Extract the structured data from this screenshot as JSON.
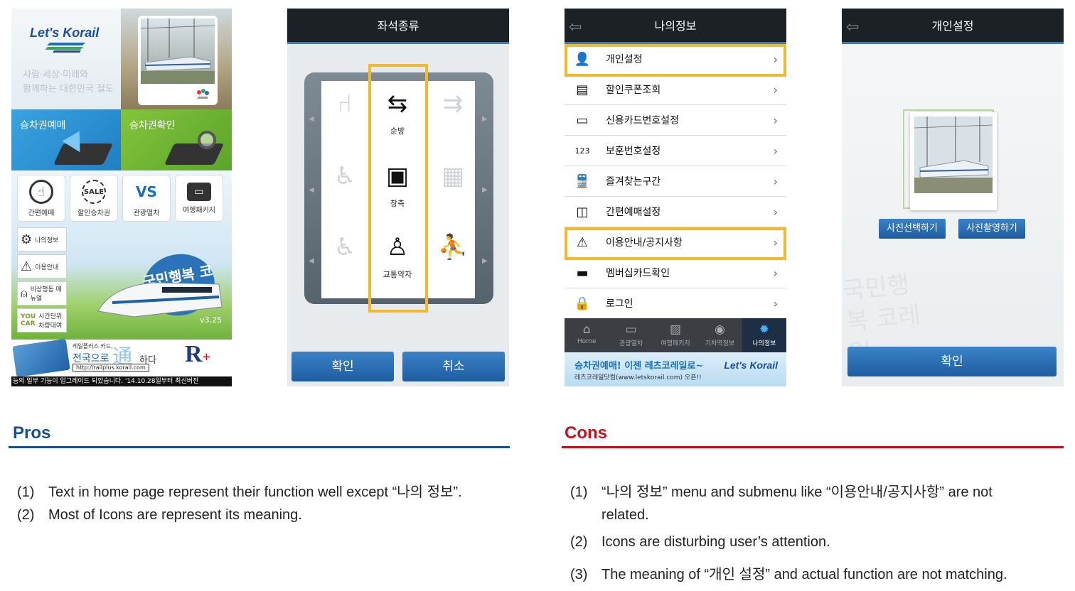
{
  "screen1": {
    "logo": "Let's Korail",
    "slogan_line1": "사람·세상·미래와",
    "slogan_line2": "함께하는 대한민국 철도",
    "tile_book": "승차권예매",
    "tile_check": "승차권확인",
    "menu": [
      "간편예매",
      "할인승차권",
      "관광열차",
      "여행패키지"
    ],
    "side": [
      "나의정보",
      "이용안내",
      "비상행동 매뉴얼",
      "시간단위 차량대여"
    ],
    "side_icons": [
      "gear-icon",
      "warning-icon",
      "emergency-icon",
      "car-icon"
    ],
    "promo": "국민행복 코레일",
    "version": "v3.25",
    "banner_line1": "레일플러스 카드,",
    "banner_line2": "전국으로",
    "banner_big": "通",
    "banner_suffix": "하다",
    "banner_url": "http://railplus.korail.com",
    "ticker": "능의 일부 기능이 업그레이드 되었습니다. '14.10.28일부터 최신버전"
  },
  "screen2": {
    "title": "좌석종류",
    "seats": [
      "순방",
      "창측",
      "교통약자"
    ],
    "ok": "확인",
    "cancel": "취소"
  },
  "screen3": {
    "title": "나의정보",
    "back_icon": "back-arrow-icon",
    "menu": [
      {
        "label": "개인설정",
        "icon": "person-gear-icon"
      },
      {
        "label": "할인쿠폰조회",
        "icon": "coupon-icon"
      },
      {
        "label": "신용카드번호설정",
        "icon": "card-icon"
      },
      {
        "label": "보훈번호설정",
        "icon": "number-icon"
      },
      {
        "label": "즐겨찾는구간",
        "icon": "train-icon"
      },
      {
        "label": "간편예매설정",
        "icon": "quick-icon"
      },
      {
        "label": "이용안내/공지사항",
        "icon": "warning-icon"
      },
      {
        "label": "멤버십카드확인",
        "icon": "membership-icon"
      },
      {
        "label": "로그인",
        "icon": "lock-icon"
      }
    ],
    "tabs": [
      "Home",
      "관광열차",
      "여행패키지",
      "기차역정보",
      "나의정보"
    ],
    "ad_line1": "승차권예매! 이젠 레츠코레일로~",
    "ad_line2": "레츠코레일닷컴(www.letskorail.com) 오픈!!",
    "ad_logo": "Let's Korail"
  },
  "screen4": {
    "title": "개인설정",
    "select_photo": "사진선택하기",
    "take_photo": "사진촬영하기",
    "ok": "확인",
    "watermark": "국민행복 코레일"
  },
  "pros": {
    "title": "Pros",
    "color": "#1a4e8c",
    "items": [
      {
        "num": "(1)",
        "text": "Text in home page represent their function well except “나의 정보”."
      },
      {
        "num": "(2)",
        "text": "Most of Icons are represent its meaning."
      }
    ]
  },
  "cons": {
    "title": "Cons",
    "color": "#c0151c",
    "items": [
      {
        "num": "(1)",
        "text": "“나의 정보” menu and submenu like “이용안내/공지사항” are not",
        "cont": "related."
      },
      {
        "num": "(2)",
        "text": "Icons are disturbing user’s attention."
      },
      {
        "num": "(3)",
        "text": "The meaning of “개인 설정” and actual function are not matching."
      }
    ]
  },
  "highlight_color": "#f5b72c"
}
